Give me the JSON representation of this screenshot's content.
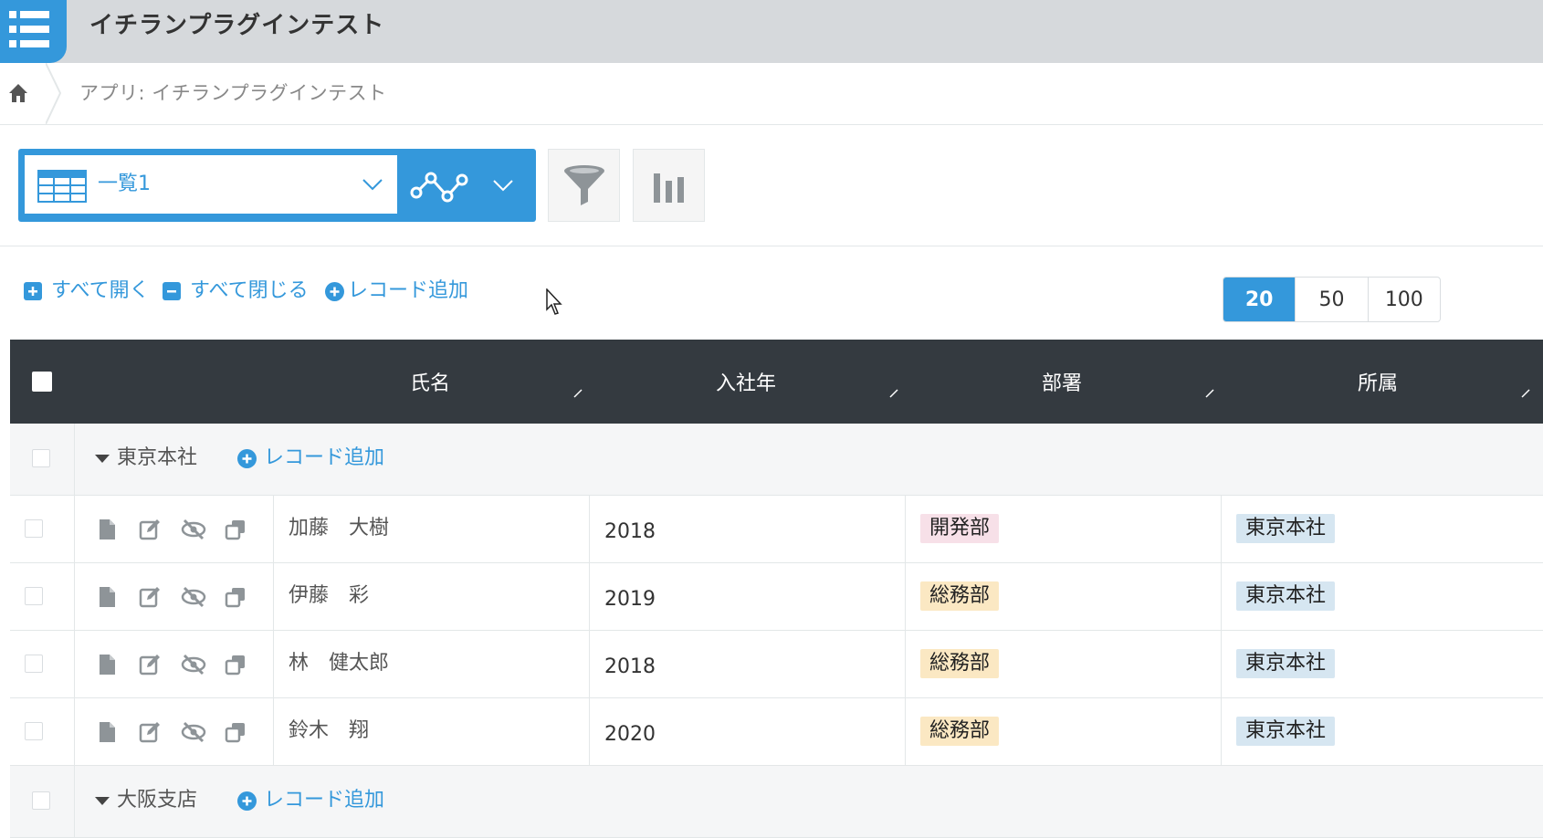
{
  "app": {
    "title": "イチランプラグインテスト"
  },
  "breadcrumb": {
    "text": "アプリ: イチランプラグインテスト"
  },
  "view": {
    "name": "一覧1"
  },
  "actions": {
    "expand_all": "すべて開く",
    "collapse_all": "すべて閉じる",
    "add_record": "レコード追加"
  },
  "pager": {
    "options": [
      "20",
      "50",
      "100"
    ],
    "selected": "20"
  },
  "table": {
    "columns": [
      "氏名",
      "入社年",
      "部署",
      "所属"
    ],
    "groups": [
      {
        "title": "東京本社",
        "add_label": "レコード追加",
        "rows": [
          {
            "name": "加藤　大樹",
            "year": "2018",
            "dept": "開発部",
            "dept_color": "#f7e0e8",
            "office": "東京本社"
          },
          {
            "name": "伊藤　彩",
            "year": "2019",
            "dept": "総務部",
            "dept_color": "#fbe8c3",
            "office": "東京本社"
          },
          {
            "name": "林　健太郎",
            "year": "2018",
            "dept": "総務部",
            "dept_color": "#fbe8c3",
            "office": "東京本社"
          },
          {
            "name": "鈴木　翔",
            "year": "2020",
            "dept": "総務部",
            "dept_color": "#fbe8c3",
            "office": "東京本社"
          }
        ]
      },
      {
        "title": "大阪支店",
        "add_label": "レコード追加",
        "rows": []
      }
    ]
  },
  "colors": {
    "accent": "#3498db",
    "header_bg": "#d6d9dc",
    "table_head": "#343a40"
  }
}
